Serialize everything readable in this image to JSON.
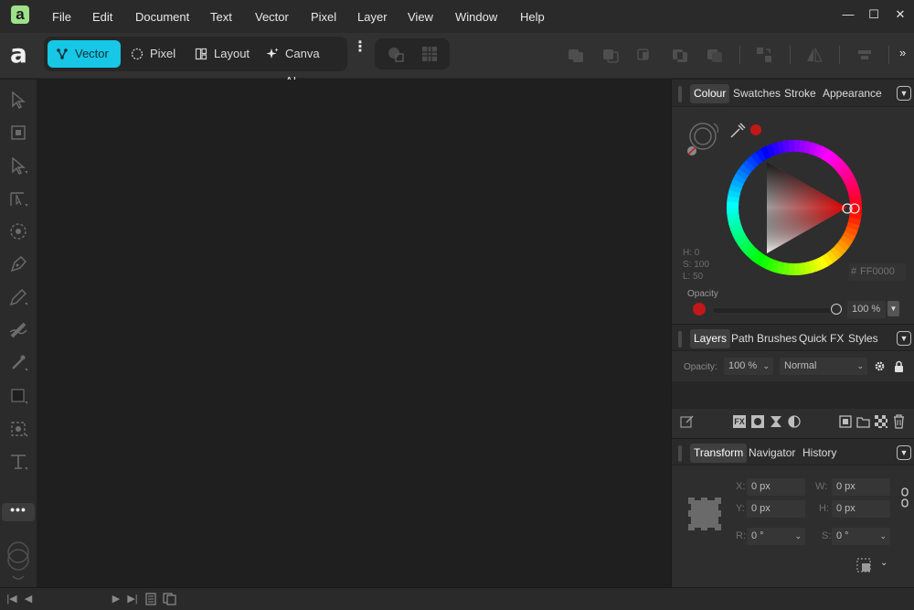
{
  "app": {
    "logo_letter": "a",
    "brand_letter": "a"
  },
  "menu": [
    "File",
    "Edit",
    "Document",
    "Text",
    "Vector",
    "Pixel",
    "Layer",
    "View",
    "Window",
    "Help"
  ],
  "window_controls": {
    "minimize": "—",
    "maximize": "☐",
    "close": "✕"
  },
  "personas": [
    {
      "label": "Vector",
      "icon": "vector-persona-icon",
      "active": true
    },
    {
      "label": "Pixel",
      "icon": "pixel-persona-icon",
      "active": false
    },
    {
      "label": "Layout",
      "icon": "layout-persona-icon",
      "active": false
    },
    {
      "label": "Canva AI",
      "icon": "canva-ai-icon",
      "active": false
    }
  ],
  "toolbar": {
    "more_label": "⋮",
    "overflow_label": "»"
  },
  "tools": {
    "items": [
      "move-tool-icon",
      "select-icon",
      "node-tool-icon",
      "corner-tool-icon",
      "point-transform-icon",
      "pen-tool-icon",
      "pencil-tool-icon",
      "brush-tool-icon",
      "fill-tool-icon",
      "shape-tool-icon",
      "crop-tool-icon",
      "text-frame-icon"
    ],
    "more_label": "•••"
  },
  "colour_panel": {
    "tabs": [
      "Colour",
      "Swatches",
      "Stroke",
      "Appearance"
    ],
    "active_tab": "Colour",
    "hsl": {
      "h": "H: 0",
      "s": "S: 100",
      "l": "L: 50"
    },
    "hex_prefix": "#",
    "hex": "FF0000",
    "opacity_label": "Opacity",
    "opacity_value": "100 %",
    "opacity": 1.0,
    "fill_color": "#e00000",
    "stroke_color": "#8a1010",
    "swatch_dot_color": "#c21818"
  },
  "layers_panel": {
    "tabs": [
      "Layers",
      "Path Brushes",
      "Quick FX",
      "Styles"
    ],
    "active_tab": "Layers",
    "opacity_label": "Opacity:",
    "opacity_value": "100 %",
    "blend_mode": "Normal",
    "footer_icons": [
      "edit-layer-icon",
      "fx-icon",
      "mask-icon",
      "adjustment-icon",
      "contrast-icon",
      "add-pixel-layer-icon",
      "add-group-icon",
      "checker-icon",
      "delete-icon"
    ]
  },
  "transform_panel": {
    "tabs": [
      "Transform",
      "Navigator",
      "History"
    ],
    "active_tab": "Transform",
    "fields": {
      "x_label": "X:",
      "x_value": "0 px",
      "y_label": "Y:",
      "y_value": "0 px",
      "w_label": "W:",
      "w_value": "0 px",
      "h_label": "H:",
      "h_value": "0 px",
      "r_label": "R:",
      "r_value": "0 °",
      "s_label": "S:",
      "s_value": "0 °"
    }
  },
  "statusbar": {
    "first": "|◀",
    "prev": "◀",
    "next": "▶",
    "last": "▶|"
  }
}
